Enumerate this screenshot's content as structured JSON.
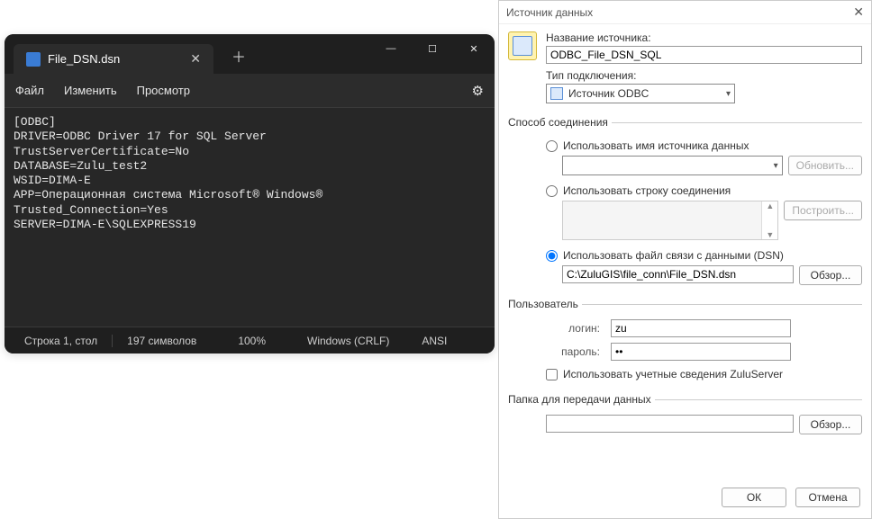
{
  "editor": {
    "tab_filename": "File_DSN.dsn",
    "menu": {
      "file": "Файл",
      "edit": "Изменить",
      "view": "Просмотр"
    },
    "content": "[ODBC]\nDRIVER=ODBC Driver 17 for SQL Server\nTrustServerCertificate=No\nDATABASE=Zulu_test2\nWSID=DIMA-E\nAPP=Операционная система Microsoft® Windows®\nTrusted_Connection=Yes\nSERVER=DIMA-E\\SQLEXPRESS19",
    "status": {
      "cursor": "Строка 1, стол",
      "chars": "197 символов",
      "zoom": "100%",
      "eol": "Windows (CRLF)",
      "encoding": "ANSI"
    }
  },
  "dialog": {
    "title": "Источник данных",
    "ds_name_label": "Название источника:",
    "ds_name_value": "ODBC_File_DSN_SQL",
    "conn_type_label": "Тип подключения:",
    "conn_type_value": "Источник ODBC",
    "group_connection": "Способ соединения",
    "radio_use_dsn_name": "Использовать имя источника данных",
    "btn_refresh": "Обновить...",
    "radio_use_conn_string": "Использовать строку соединения",
    "btn_build": "Построить...",
    "radio_use_dsn_file": "Использовать файл связи с данными (DSN)",
    "dsn_file_path": "C:\\ZuluGIS\\file_conn\\File_DSN.dsn",
    "btn_browse": "Обзор...",
    "group_user": "Пользователь",
    "login_label": "логин:",
    "login_value": "zu",
    "password_label": "пароль:",
    "password_value": "••",
    "checkbox_zuluserver": "Использовать учетные сведения ZuluServer",
    "group_transfer": "Папка для передачи данных",
    "transfer_path": "",
    "btn_ok": "ОК",
    "btn_cancel": "Отмена"
  }
}
